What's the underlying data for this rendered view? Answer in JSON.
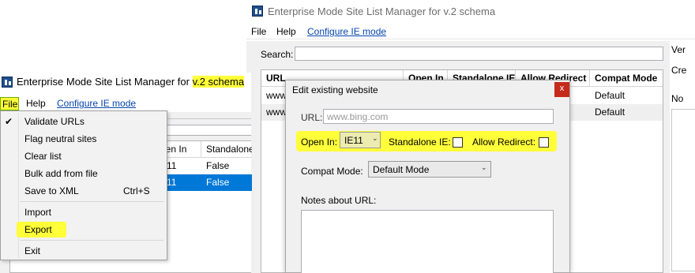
{
  "back_window": {
    "title": "Enterprise Mode Site List Manager for v.2 schema",
    "menu": {
      "file": "File",
      "help": "Help",
      "configure": "Configure IE mode"
    },
    "search_label": "Search:",
    "columns": {
      "url": "URL",
      "open_in": "Open In",
      "standalone": "Standalone IE",
      "allow": "Allow Redirect",
      "compat": "Compat Mode"
    },
    "rows": [
      {
        "url": "www",
        "compat": "Default"
      },
      {
        "url": "www",
        "compat": "Default"
      }
    ],
    "side_labels": {
      "ver": "Ver",
      "cre": "Cre",
      "no": "No"
    }
  },
  "front_window": {
    "title_prefix": "Enterprise Mode Site List Manager for ",
    "title_highlight": "v.2 schema",
    "menu": {
      "file": "File",
      "help": "Help",
      "configure": "Configure IE mode"
    },
    "columns": {
      "open_in": "pen In",
      "standalone": "Standalone"
    },
    "rows": [
      {
        "open_in": "11",
        "standalone": "False"
      },
      {
        "open_in": "11",
        "standalone": "False"
      }
    ]
  },
  "file_menu": {
    "validate": "Validate URLs",
    "flag": "Flag neutral sites",
    "clear": "Clear list",
    "bulk_add": "Bulk add from file",
    "save_xml": "Save to XML",
    "save_shortcut": "Ctrl+S",
    "import": "Import",
    "export": "Export",
    "exit": "Exit"
  },
  "dialog": {
    "title": "Edit existing website",
    "close": "x",
    "url_label": "URL:",
    "url_placeholder": "www.bing.com",
    "open_in_label": "Open In:",
    "open_in_value": "IE11",
    "standalone_label": "Standalone IE:",
    "allow_redirect_label": "Allow Redirect:",
    "compat_label": "Compat Mode:",
    "compat_value": "Default Mode",
    "notes_label": "Notes about URL:"
  },
  "colors": {
    "selection": "#0078d7",
    "highlight": "#ffff3a",
    "close_button": "#c42b1c",
    "link": "#0645ad"
  }
}
